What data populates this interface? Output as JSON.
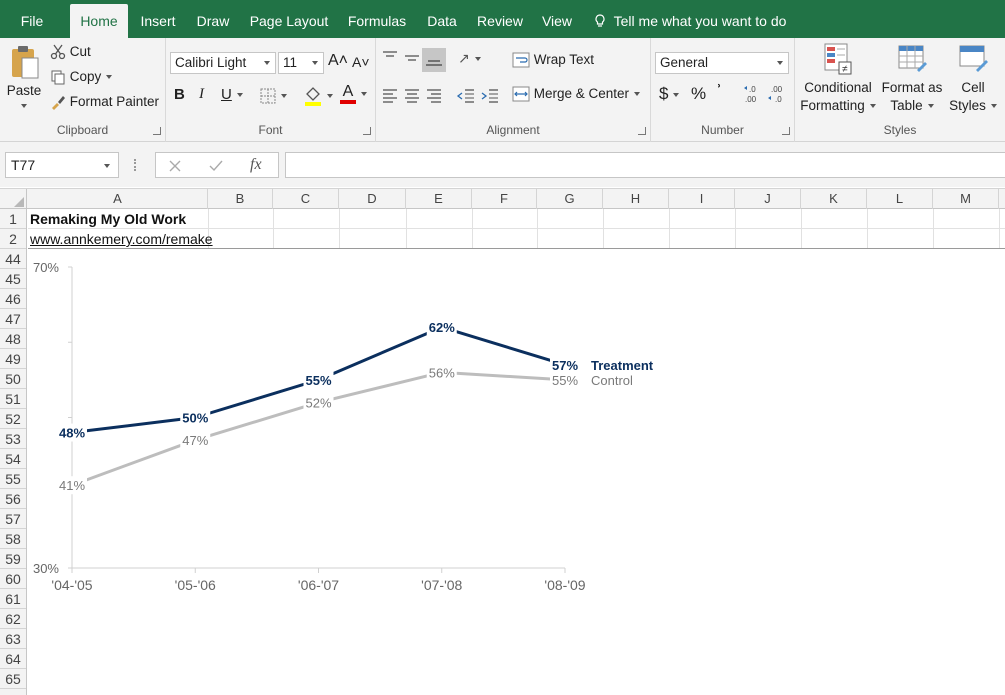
{
  "tabs": [
    {
      "label": "File",
      "active": false
    },
    {
      "label": "Home",
      "active": true
    },
    {
      "label": "Insert",
      "active": false
    },
    {
      "label": "Draw",
      "active": false
    },
    {
      "label": "Page Layout",
      "active": false
    },
    {
      "label": "Formulas",
      "active": false
    },
    {
      "label": "Data",
      "active": false
    },
    {
      "label": "Review",
      "active": false
    },
    {
      "label": "View",
      "active": false
    }
  ],
  "tell_me": "Tell me what you want to do",
  "clipboard": {
    "paste": "Paste",
    "cut": "Cut",
    "copy": "Copy",
    "format_painter": "Format Painter",
    "label": "Clipboard"
  },
  "font": {
    "name": "Calibri Light",
    "size": "11",
    "bold": "B",
    "italic": "I",
    "underline": "U",
    "color_letter": "A",
    "label": "Font"
  },
  "alignment": {
    "wrap_text": "Wrap Text",
    "merge_center": "Merge & Center",
    "label": "Alignment"
  },
  "number": {
    "format": "General",
    "currency": "$",
    "percent": "%",
    "comma": "͗",
    "label": "Number"
  },
  "styles": {
    "conditional": "Conditional",
    "formatting": "Formatting",
    "format_as": "Format as",
    "table": "Table",
    "cell": "Cell",
    "cell_styles": "Styles",
    "label": "Styles"
  },
  "formula_bar": {
    "name_box": "T77",
    "formula": ""
  },
  "columns": [
    "A",
    "B",
    "C",
    "D",
    "E",
    "F",
    "G",
    "H",
    "I",
    "J",
    "K",
    "L",
    "M"
  ],
  "rows": [
    "1",
    "2",
    "44",
    "45",
    "46",
    "47",
    "48",
    "49",
    "50",
    "51",
    "52",
    "53",
    "54",
    "55",
    "56",
    "57",
    "58",
    "59",
    "60",
    "61",
    "62",
    "63",
    "64",
    "65"
  ],
  "sheet": {
    "title": "Remaking My Old Work",
    "link": "www.annkemery.com/remake"
  },
  "colors": {
    "ribbon_green": "#217346",
    "treatment": "#0b2f5e",
    "control": "#bdbdbd",
    "control_label": "#7a7a7a"
  },
  "chart_data": {
    "type": "line",
    "categories": [
      "'04-'05",
      "'05-'06",
      "'06-'07",
      "'07-'08",
      "'08-'09"
    ],
    "ylim": [
      30,
      70
    ],
    "ytick_labels": [
      "30%",
      "70%"
    ],
    "series": [
      {
        "name": "Treatment",
        "values": [
          48,
          50,
          55,
          62,
          57
        ],
        "labels": [
          "48%",
          "50%",
          "55%",
          "62%",
          "57%"
        ]
      },
      {
        "name": "Control",
        "values": [
          41,
          47,
          52,
          56,
          55
        ],
        "labels": [
          "41%",
          "47%",
          "52%",
          "56%",
          "55%"
        ]
      }
    ]
  }
}
